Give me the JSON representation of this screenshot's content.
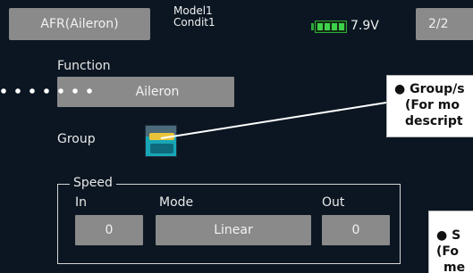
{
  "header": {
    "title": "AFR(Aileron)",
    "model_line1": "Model1",
    "model_line2": "Condit1",
    "voltage": "7.9V",
    "page": "2/2"
  },
  "function": {
    "label": "Function",
    "value": "Aileron"
  },
  "group": {
    "label": "Group",
    "icon": "group-single-mode-icon"
  },
  "speed": {
    "legend": "Speed",
    "in_label": "In",
    "mode_label": "Mode",
    "out_label": "Out",
    "in_value": "0",
    "mode_value": "Linear",
    "out_value": "0"
  },
  "callouts": {
    "group_line1": "● Group/s",
    "group_line2": "(For mo",
    "group_line3": "descript",
    "speed_line1": "● S",
    "speed_line2": "(Fo",
    "speed_line3": "me"
  },
  "colors": {
    "screen_bg": "#0b1622",
    "button_gray": "#8a8a8a",
    "battery_green": "#3ed24a",
    "icon_teal": "#18a6b6"
  }
}
